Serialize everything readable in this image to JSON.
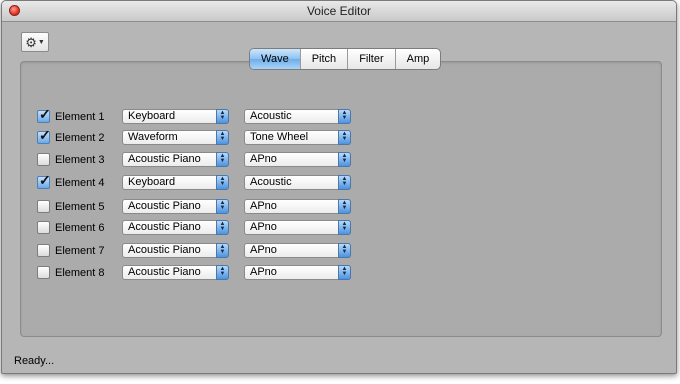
{
  "window": {
    "title": "Voice Editor"
  },
  "tabs": [
    {
      "label": "Wave",
      "active": true
    },
    {
      "label": "Pitch",
      "active": false
    },
    {
      "label": "Filter",
      "active": false
    },
    {
      "label": "Amp",
      "active": false
    }
  ],
  "elements": [
    {
      "label": "Element 1",
      "checked": true,
      "type": "Keyboard",
      "voice": "Acoustic"
    },
    {
      "label": "Element 2",
      "checked": true,
      "type": "Waveform",
      "voice": "Tone Wheel"
    },
    {
      "label": "Element 3",
      "checked": false,
      "type": "Acoustic Piano",
      "voice": "APno"
    },
    {
      "label": "Element 4",
      "checked": true,
      "type": "Keyboard",
      "voice": "Acoustic"
    },
    {
      "label": "Element 5",
      "checked": false,
      "type": "Acoustic Piano",
      "voice": "APno"
    },
    {
      "label": "Element 6",
      "checked": false,
      "type": "Acoustic Piano",
      "voice": "APno"
    },
    {
      "label": "Element 7",
      "checked": false,
      "type": "Acoustic Piano",
      "voice": "APno"
    },
    {
      "label": "Element 8",
      "checked": false,
      "type": "Acoustic Piano",
      "voice": "APno"
    }
  ],
  "status": {
    "text": "Ready..."
  },
  "icons": {
    "gear": "gear-icon",
    "close": "close-icon"
  },
  "colors": {
    "accent": "#6eaee9",
    "close_button": "#e2382a",
    "window_bg": "#b6b6b6"
  }
}
